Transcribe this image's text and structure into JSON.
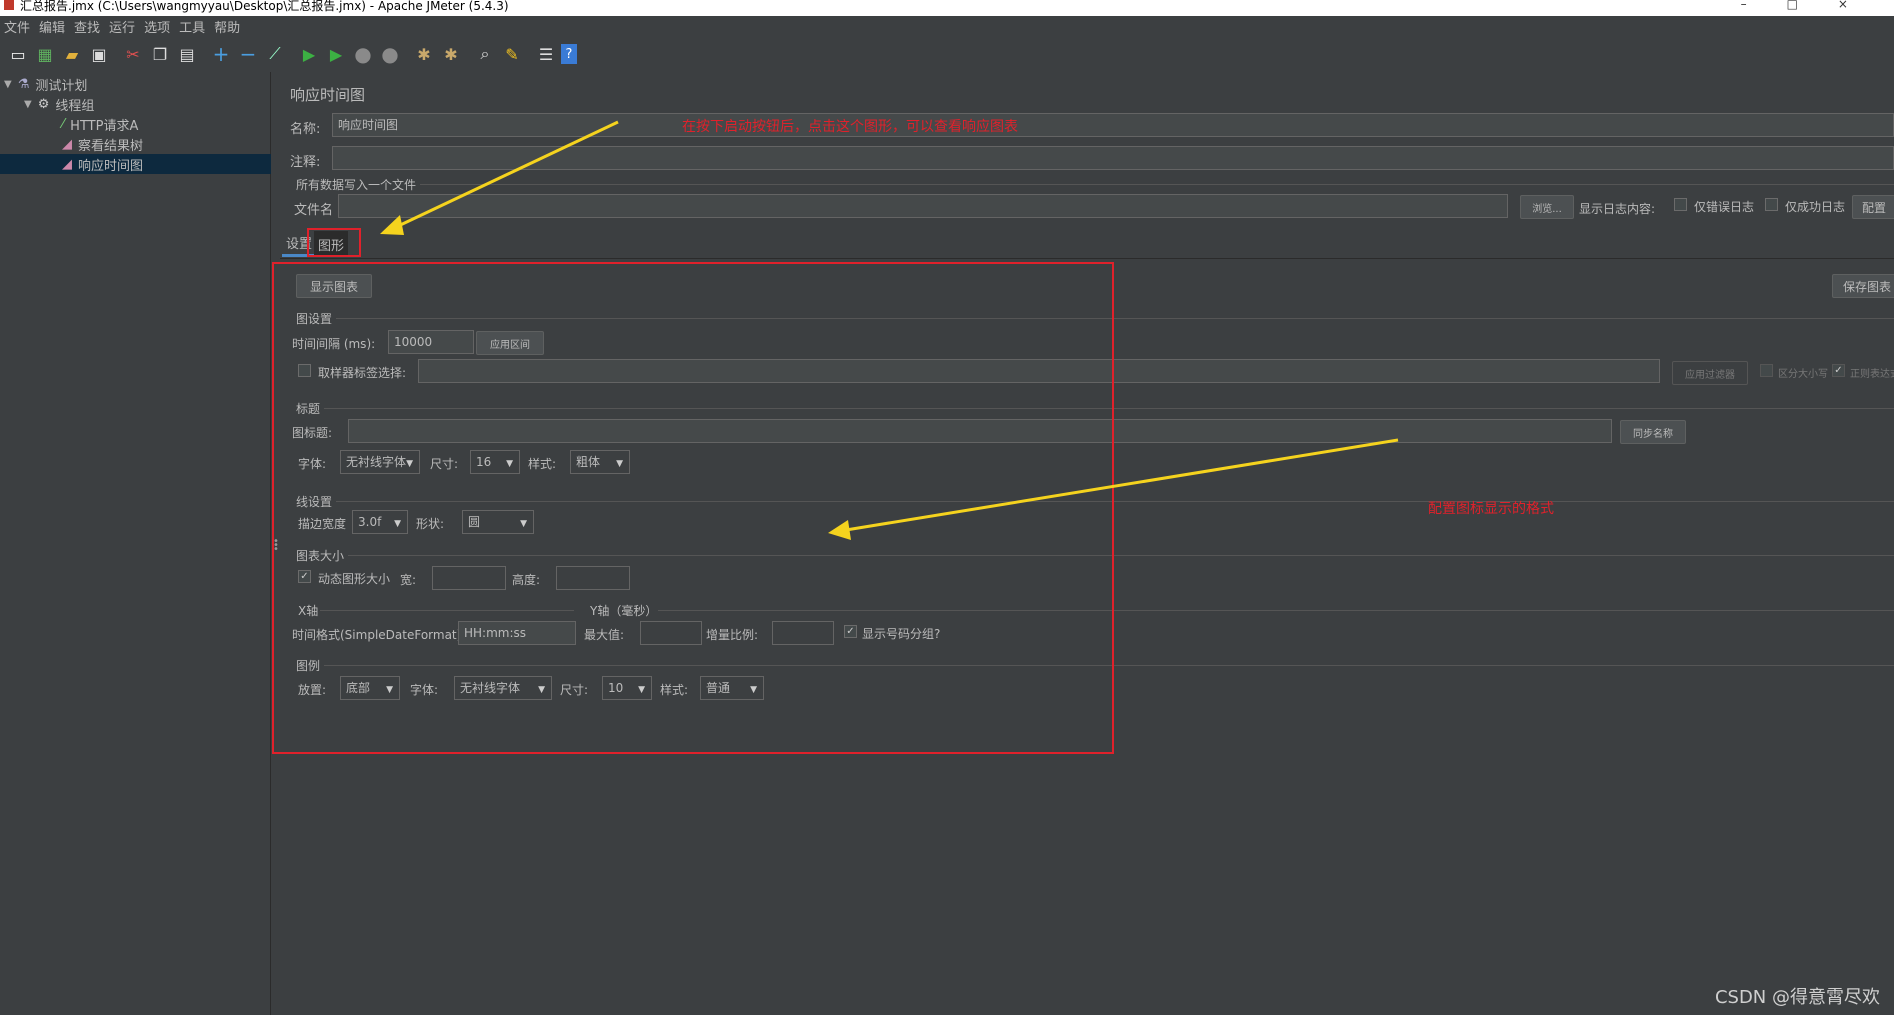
{
  "window": {
    "title": "汇总报告.jmx (C:\\Users\\wangmyyau\\Desktop\\汇总报告.jmx) - Apache JMeter (5.4.3)"
  },
  "menu": [
    "文件",
    "编辑",
    "查找",
    "运行",
    "选项",
    "工具",
    "帮助"
  ],
  "toolbar": {
    "icons": [
      "new-icon",
      "templates-icon",
      "open-icon",
      "save-icon",
      "cut-icon",
      "copy-icon",
      "paste-icon",
      "expand-icon",
      "collapse-icon",
      "toggle-icon",
      "start-icon",
      "start-no-pause-icon",
      "stop-icon",
      "shutdown-icon",
      "clear-icon",
      "clear-all-icon",
      "search-icon",
      "reset-search-icon",
      "function-helper-icon",
      "help-icon"
    ]
  },
  "tree": {
    "items": [
      {
        "label": "测试计划",
        "icon": "flask-icon"
      },
      {
        "label": "线程组",
        "icon": "gear-icon"
      },
      {
        "label": "HTTP请求A",
        "icon": "pipette-icon"
      },
      {
        "label": "察看结果树",
        "icon": "chart-icon"
      },
      {
        "label": "响应时间图",
        "icon": "chart-icon"
      }
    ]
  },
  "panel": {
    "title": "响应时间图",
    "name_label": "名称:",
    "name_value": "响应时间图",
    "comment_label": "注释:",
    "file_section": "所有数据写入一个文件",
    "filename_label": "文件名",
    "browse_label": "浏览...",
    "log_label": "显示日志内容:",
    "errors_only": "仅错误日志",
    "success_only": "仅成功日志",
    "configure": "配置"
  },
  "tabs": [
    "设置",
    "图形"
  ],
  "graph": {
    "show_chart": "显示图表",
    "save_chart": "保存图表",
    "settings_section": "图设置",
    "interval_label": "时间间隔 (ms):",
    "interval_value": "10000",
    "apply_interval": "应用区间",
    "sampler_label": "取样器标签选择:",
    "apply_filter": "应用过滤器",
    "case_sensitive": "区分大小写",
    "regex": "正则表达式",
    "title_section": "标题",
    "graph_title_label": "图标题:",
    "sync_name": "同步名称",
    "font_label": "字体:",
    "font_value": "无衬线字体",
    "size_label": "尺寸:",
    "size_value": "16",
    "style_label": "样式:",
    "style_value": "粗体",
    "line_section": "线设置",
    "stroke_label": "描边宽度",
    "stroke_value": "3.0f",
    "shape_label": "形状:",
    "shape_value": "圆",
    "chart_size_section": "图表大小",
    "dynamic_size": "动态图形大小",
    "width_label": "宽:",
    "height_label": "高度:",
    "x_axis_section": "X轴",
    "y_axis_section": "Y轴（毫秒）",
    "time_format_label": "时间格式(SimpleDateFormat):",
    "time_format_value": "HH:mm:ss",
    "max_label": "最大值:",
    "increment_label": "增量比例:",
    "group_digits": "显示号码分组?",
    "legend_section": "图例",
    "placement_label": "放置:",
    "placement_value": "底部",
    "legend_font_label": "字体:",
    "legend_font_value": "无衬线字体",
    "legend_size_label": "尺寸:",
    "legend_size_value": "10",
    "legend_style_label": "样式:",
    "legend_style_value": "普通"
  },
  "annotations": {
    "top": "在按下启动按钮后，点击这个图形，可以查看响应图表",
    "right": "配置图标显示的格式"
  },
  "watermark": "CSDN @得意霄尽欢",
  "colors": {
    "annotation": "#e0212b",
    "arrow": "#f5d31e",
    "bg": "#3c3f41",
    "selection": "#0d293e"
  }
}
